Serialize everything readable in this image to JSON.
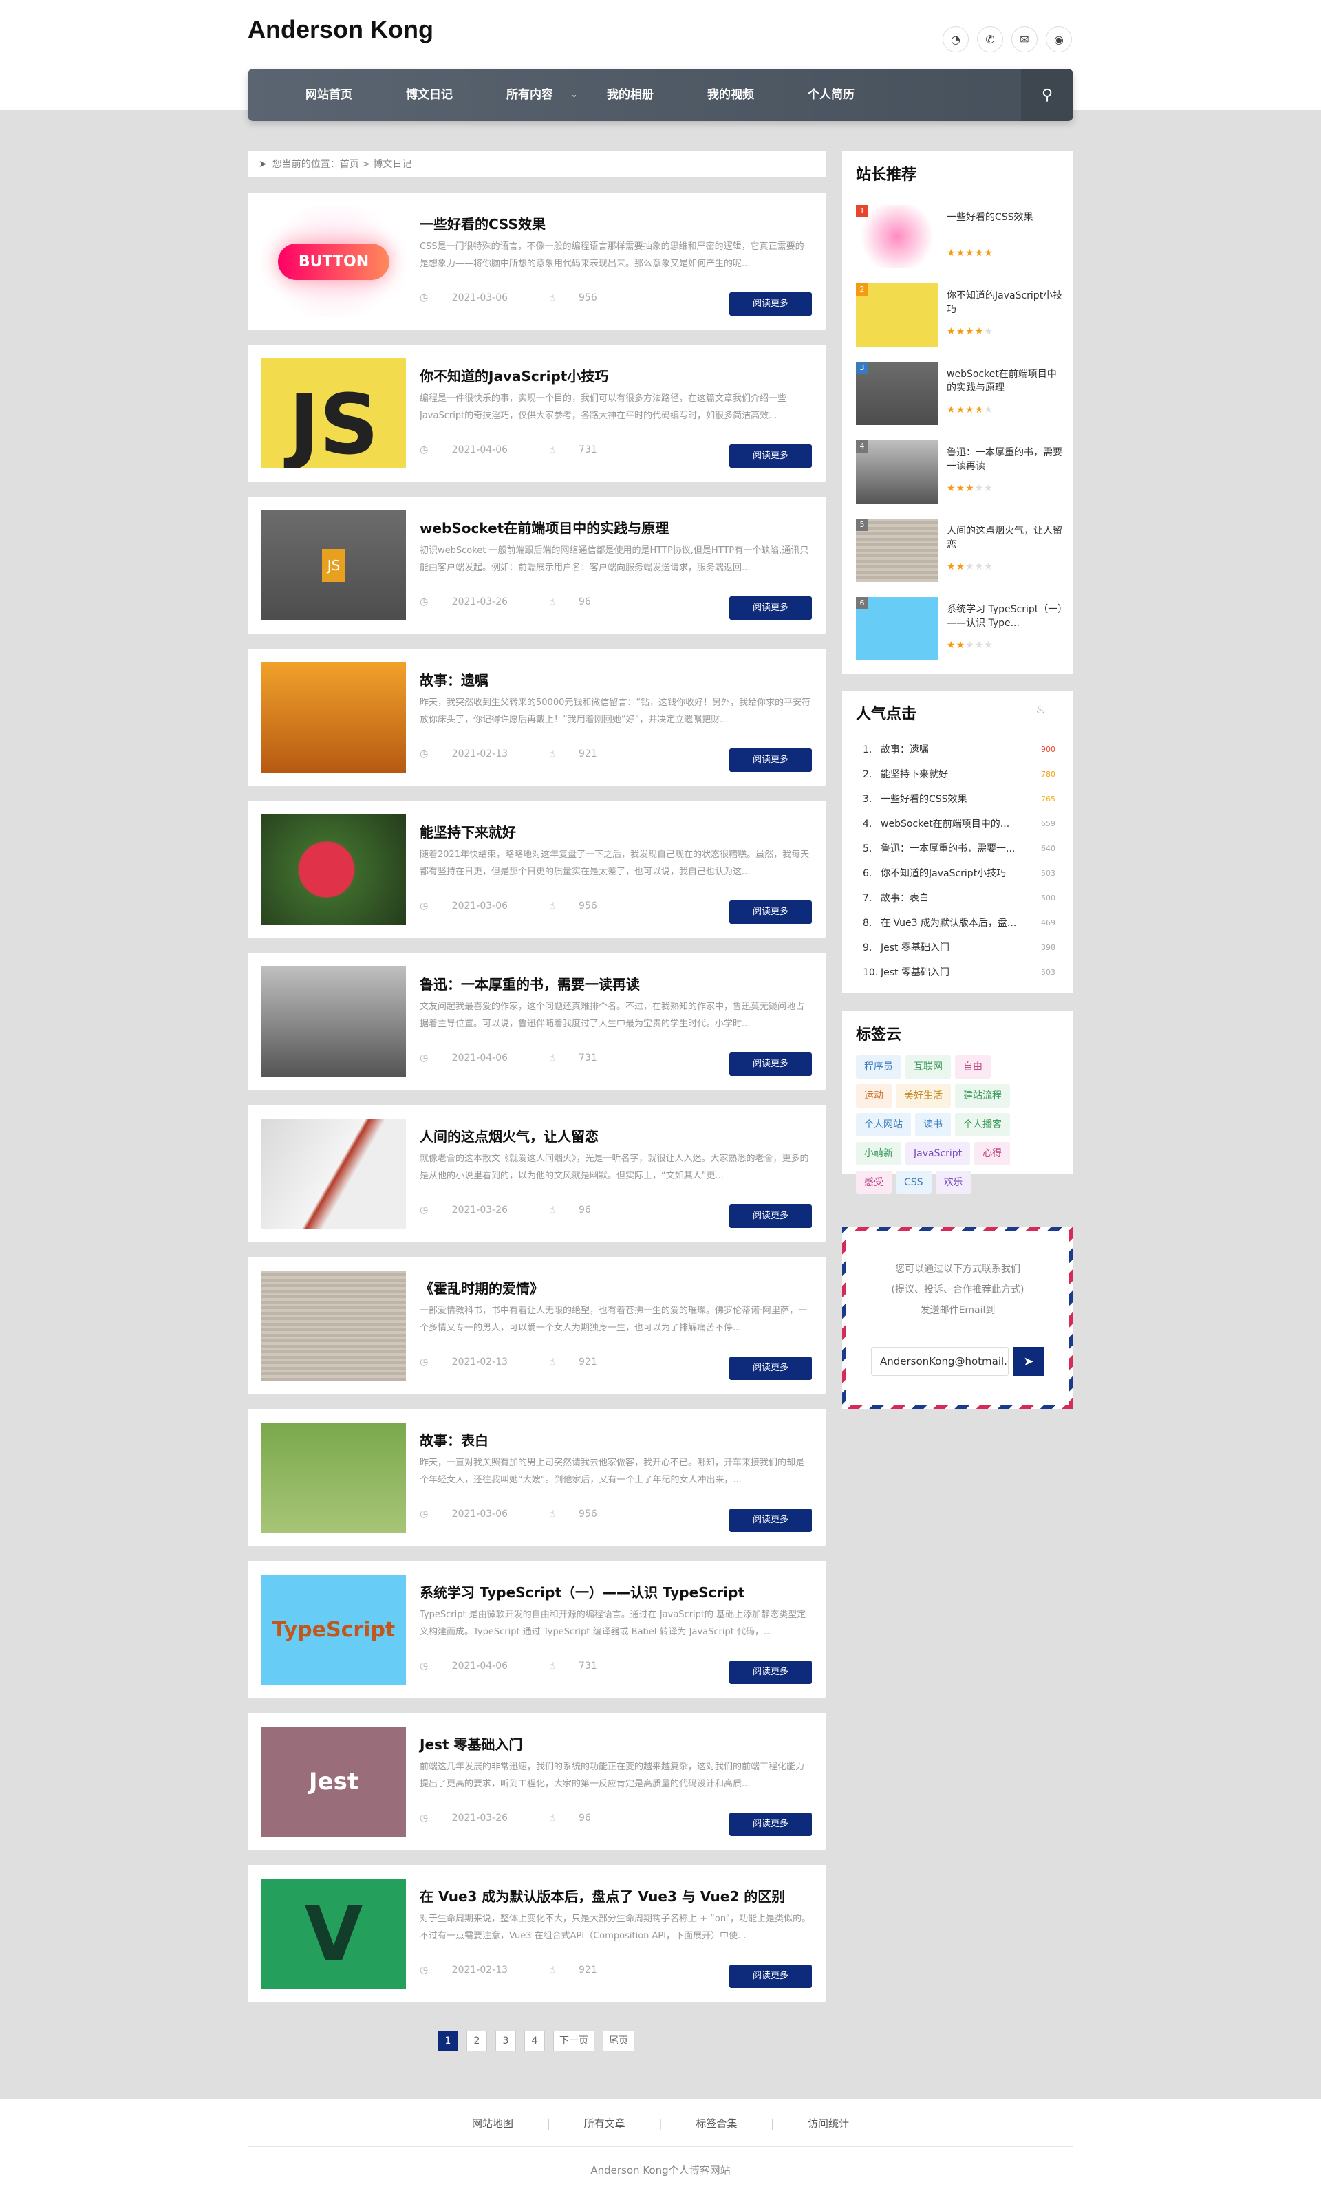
{
  "header": {
    "logo": "Anderson Kong",
    "icons": [
      "qq-icon",
      "phone-icon",
      "mail-icon",
      "wechat-icon"
    ]
  },
  "nav": {
    "items": [
      "网站首页",
      "博文日记",
      "所有内容",
      "我的相册",
      "我的视频",
      "个人简历"
    ]
  },
  "breadcrumb": {
    "text": "您当前的位置：首页 > 博文日记"
  },
  "articles": [
    {
      "title": "一些好看的CSS效果",
      "desc": "CSS是一门很特殊的语言，不像一般的编程语言那样需要抽象的思维和严密的逻辑，它真正需要的是想象力——将你脑中所想的意象用代码来表现出来。那么意象又是如何产生的呢...",
      "date": "2021-03-06",
      "likes": "956",
      "btn": "阅读更多"
    },
    {
      "title": "你不知道的JavaScript小技巧",
      "desc": "编程是一件很快乐的事，实现一个目的，我们可以有很多方法路径，在这篇文章我们介绍一些JavaScript的奇技淫巧，仅供大家参考，各路大神在平时的代码编写时，如很多简洁高效...",
      "date": "2021-04-06",
      "likes": "731",
      "btn": "阅读更多"
    },
    {
      "title": "webSocket在前端项目中的实践与原理",
      "desc": "初识webScoket 一般前端跟后端的网络通信都是使用的是HTTP协议,但是HTTP有一个缺陷,通讯只能由客户端发起。例如：前端展示用户名：客户端向服务端发送请求，服务端返回...",
      "date": "2021-03-26",
      "likes": "96",
      "btn": "阅读更多"
    },
    {
      "title": "故事：遗嘱",
      "desc": "昨天，我突然收到生父转来的50000元钱和微信留言：“钻，这钱你收好！另外，我给你求的平安符放你床头了，你记得许愿后再戴上！”我用着刚回她“好”，并决定立遗嘱把财...",
      "date": "2021-02-13",
      "likes": "921",
      "btn": "阅读更多"
    },
    {
      "title": "能坚持下来就好",
      "desc": "随着2021年快结束，略略地对这年复盘了一下之后，我发现自己现在的状态很糟糕。虽然，我每天都有坚持在日更，但是那个日更的质量实在是太差了，也可以说，我自己也认为这...",
      "date": "2021-03-06",
      "likes": "956",
      "btn": "阅读更多"
    },
    {
      "title": "鲁迅：一本厚重的书，需要一读再读",
      "desc": "文友问起我最喜爱的作家，这个问题还真难排个名。不过，在我熟知的作家中，鲁迅莫无疑问地占据着主导位置。可以说，鲁迅伴随着我度过了人生中最为宝贵的学生时代。小学时...",
      "date": "2021-04-06",
      "likes": "731",
      "btn": "阅读更多"
    },
    {
      "title": "人间的这点烟火气，让人留恋",
      "desc": "就像老舍的这本散文《就爱这人间烟火》，光是一听名字，就很让人入迷。大家熟悉的老舍，更多的是从他的小说里看到的，以为他的文风就是幽默。但实际上，“文如其人”更...",
      "date": "2021-03-26",
      "likes": "96",
      "btn": "阅读更多"
    },
    {
      "title": "《霍乱时期的爱情》",
      "desc": "一部爱情教科书，书中有着让人无限的绝望，也有着苍拂一生的爱的璀璨。佛罗伦蒂诺·阿里萨，一个多情又专一的男人，可以爱一个女人为期独身一生，也可以为了排解痛苦不停...",
      "date": "2021-02-13",
      "likes": "921",
      "btn": "阅读更多"
    },
    {
      "title": "故事：表白",
      "desc": "昨天，一直对我关照有加的男上司突然请我去他家做客，我开心不已。哪知，开车来接我们的却是个年轻女人，还往我叫她“大嫂”。到他家后，又有一个上了年纪的女人冲出来，...",
      "date": "2021-03-06",
      "likes": "956",
      "btn": "阅读更多"
    },
    {
      "title": "系统学习 TypeScript（一）——认识 TypeScript",
      "desc": "TypeScript 是由微软开发的自由和开源的编程语言。通过在 JavaScript的 基础上添加静态类型定义构建而成。TypeScript 通过 TypeScript 编译器或 Babel 转译为 JavaScript 代码，...",
      "date": "2021-04-06",
      "likes": "731",
      "btn": "阅读更多"
    },
    {
      "title": "Jest 零基础入门",
      "desc": "前端这几年发展的非常迅速，我们的系统的功能正在变的越来越复杂，这对我们的前端工程化能力提出了更高的要求，听到工程化，大家的第一反应肯定是高质量的代码设计和高质...",
      "date": "2021-03-26",
      "likes": "96",
      "btn": "阅读更多"
    },
    {
      "title": "在 Vue3 成为默认版本后，盘点了 Vue3 与 Vue2 的区别",
      "desc": "对于生命周期来说，整体上变化不大，只是大部分生命周期钩子名称上 + “on”，功能上是类似的。不过有一点需要注意，Vue3 在组合式API（Composition API，下面展开）中使...",
      "date": "2021-02-13",
      "likes": "921",
      "btn": "阅读更多"
    }
  ],
  "pagination": {
    "pages": [
      "1",
      "2",
      "3",
      "4"
    ],
    "next": "下一页",
    "last": "尾页",
    "current": "1"
  },
  "recommend": {
    "title": "站长推荐",
    "items": [
      {
        "num": "1",
        "title": "一些好看的CSS效果",
        "stars": 5
      },
      {
        "num": "2",
        "title": "你不知道的JavaScript小技巧",
        "stars": 4
      },
      {
        "num": "3",
        "title": "webSocket在前端项目中的实践与原理",
        "stars": 4
      },
      {
        "num": "4",
        "title": "鲁迅：一本厚重的书，需要一读再读",
        "stars": 3
      },
      {
        "num": "5",
        "title": "人间的这点烟火气，让人留恋",
        "stars": 2
      },
      {
        "num": "6",
        "title": "系统学习 TypeScript（一）——认识 Type...",
        "stars": 2
      }
    ]
  },
  "hot": {
    "title": "人气点击",
    "items": [
      {
        "rank": "1.",
        "title": "故事：遗嘱",
        "count": "900",
        "color": "#e8452d"
      },
      {
        "rank": "2.",
        "title": "能坚持下来就好",
        "count": "780",
        "color": "#f39c12"
      },
      {
        "rank": "3.",
        "title": "一些好看的CSS效果",
        "count": "765",
        "color": "#f1b11b"
      },
      {
        "rank": "4.",
        "title": "webSocket在前端项目中的...",
        "count": "659",
        "color": "#aaaaaa"
      },
      {
        "rank": "5.",
        "title": "鲁迅：一本厚重的书，需要一...",
        "count": "640",
        "color": "#aaaaaa"
      },
      {
        "rank": "6.",
        "title": "你不知道的JavaScript小技巧",
        "count": "503",
        "color": "#aaaaaa"
      },
      {
        "rank": "7.",
        "title": "故事：表白",
        "count": "500",
        "color": "#aaaaaa"
      },
      {
        "rank": "8.",
        "title": "在 Vue3 成为默认版本后，盘...",
        "count": "469",
        "color": "#aaaaaa"
      },
      {
        "rank": "9.",
        "title": "Jest 零基础入门",
        "count": "398",
        "color": "#aaaaaa"
      },
      {
        "rank": "10.",
        "title": "Jest 零基础入门",
        "count": "503",
        "color": "#aaaaaa"
      }
    ]
  },
  "tags": {
    "title": "标签云",
    "items": [
      {
        "label": "程序员",
        "bg": "#e8f3fb",
        "fg": "#3a7bc0"
      },
      {
        "label": "互联网",
        "bg": "#eaf6ee",
        "fg": "#3a9b5a"
      },
      {
        "label": "自由",
        "bg": "#fbeaf3",
        "fg": "#c04a8a"
      },
      {
        "label": "运动",
        "bg": "#fdf0e6",
        "fg": "#d1782f"
      },
      {
        "label": "美好生活",
        "bg": "#fdf3e3",
        "fg": "#c48a1f"
      },
      {
        "label": "建站流程",
        "bg": "#eaf6ee",
        "fg": "#3a9b5a"
      },
      {
        "label": "个人网站",
        "bg": "#e8f3fb",
        "fg": "#3a7bc0"
      },
      {
        "label": "读书",
        "bg": "#e8f3fb",
        "fg": "#3a7bc0"
      },
      {
        "label": "个人播客",
        "bg": "#eaf6ee",
        "fg": "#3a9b5a"
      },
      {
        "label": "小萌新",
        "bg": "#eaf6ee",
        "fg": "#3a9b5a"
      },
      {
        "label": "JavaScript",
        "bg": "#f2ecfb",
        "fg": "#7a4ac0"
      },
      {
        "label": "心得",
        "bg": "#fbeaf3",
        "fg": "#c04a8a"
      },
      {
        "label": "感受",
        "bg": "#fbeaf3",
        "fg": "#c04a8a"
      },
      {
        "label": "CSS",
        "bg": "#e8f3fb",
        "fg": "#3a7bc0"
      },
      {
        "label": "欢乐",
        "bg": "#f2ecfb",
        "fg": "#7a4ac0"
      }
    ]
  },
  "contact": {
    "line1": "您可以通过以下方式联系我们",
    "line2": "(提议、投诉、合作推荐此方式)",
    "line3": "发送邮件Email到",
    "email": "AndersonKong@hotmail.com"
  },
  "footer": {
    "links": [
      "网站地图",
      "所有文章",
      "标签合集",
      "访问统计"
    ],
    "copyright": "Anderson Kong个人博客网站"
  },
  "colors": {
    "accent": "#0d2b7a",
    "nav": "#4f5963",
    "star": "#f39c12"
  }
}
